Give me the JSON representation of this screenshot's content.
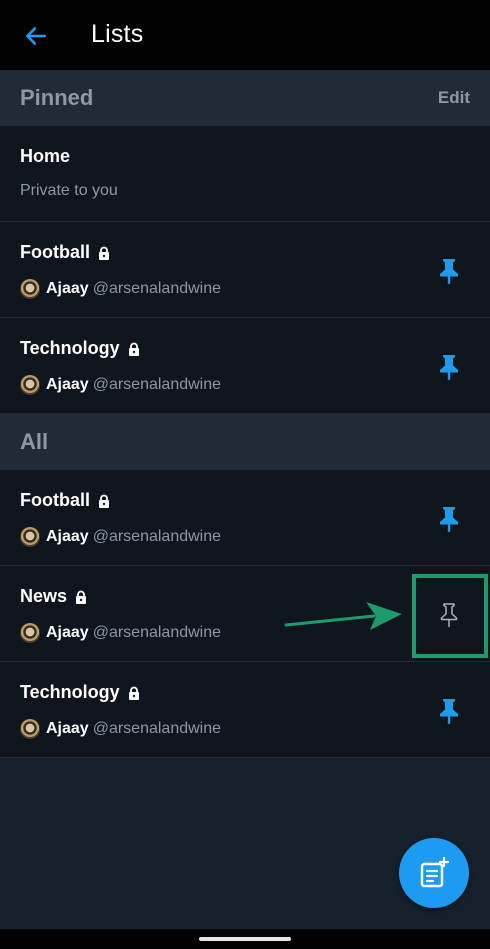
{
  "header": {
    "title": "Lists"
  },
  "pinned": {
    "title": "Pinned",
    "edit_label": "Edit",
    "items": [
      {
        "title": "Home",
        "subtitle": "Private to you"
      },
      {
        "title": "Football",
        "owner_name": "Ajaay",
        "owner_handle": "@arsenalandwine",
        "pinned": true
      },
      {
        "title": "Technology",
        "owner_name": "Ajaay",
        "owner_handle": "@arsenalandwine",
        "pinned": true
      }
    ]
  },
  "all": {
    "title": "All",
    "items": [
      {
        "title": "Football",
        "owner_name": "Ajaay",
        "owner_handle": "@arsenalandwine",
        "pinned": true
      },
      {
        "title": "News",
        "owner_name": "Ajaay",
        "owner_handle": "@arsenalandwine",
        "pinned": false
      },
      {
        "title": "Technology",
        "owner_name": "Ajaay",
        "owner_handle": "@arsenalandwine",
        "pinned": true
      }
    ]
  },
  "colors": {
    "accent": "#1d9bf0",
    "header_bg": "#000000",
    "section_bg": "#202b38",
    "row_bg": "#0e151d",
    "highlight": "#1f9a6c"
  },
  "icons": {
    "back": "arrow-left-icon",
    "lock": "lock-icon",
    "pin_filled": "pin-filled-icon",
    "pin_outline": "pin-outline-icon",
    "fab": "new-list-icon"
  }
}
